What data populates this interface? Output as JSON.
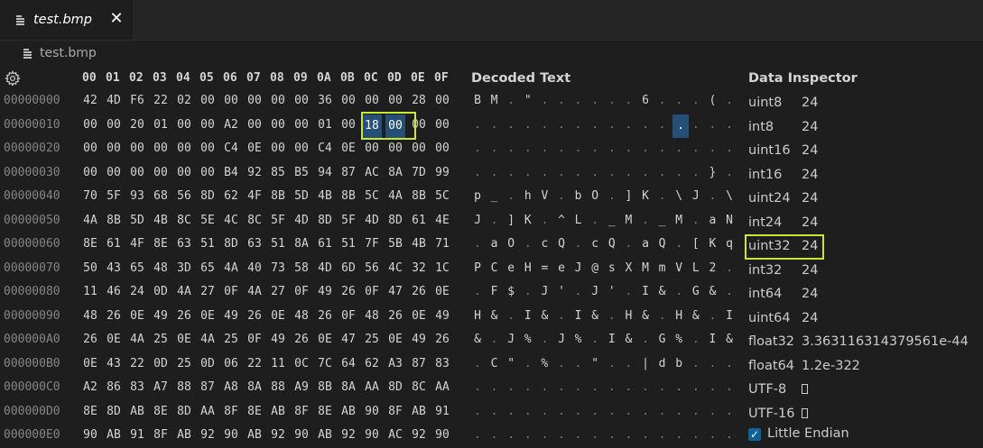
{
  "tab": {
    "title": "test.bmp",
    "close_glyph": "✕"
  },
  "breadcrumb": {
    "label": "test.bmp"
  },
  "icons": {
    "file": "file-icon",
    "settings": "gear-icon"
  },
  "hex_view": {
    "columns": [
      "00",
      "01",
      "02",
      "03",
      "04",
      "05",
      "06",
      "07",
      "08",
      "09",
      "0A",
      "0B",
      "0C",
      "0D",
      "0E",
      "0F"
    ],
    "rows": [
      {
        "addr": "00000000",
        "bytes": [
          "42",
          "4D",
          "F6",
          "22",
          "02",
          "00",
          "00",
          "00",
          "00",
          "00",
          "36",
          "00",
          "00",
          "00",
          "28",
          "00"
        ],
        "text": [
          "B",
          "M",
          ".",
          "\"",
          ".",
          ".",
          ".",
          ".",
          ".",
          ".",
          "6",
          ".",
          ".",
          ".",
          "(",
          "."
        ]
      },
      {
        "addr": "00000010",
        "bytes": [
          "00",
          "00",
          "20",
          "01",
          "00",
          "00",
          "A2",
          "00",
          "00",
          "00",
          "01",
          "00",
          "18",
          "00",
          "00",
          "00"
        ],
        "text": [
          ".",
          ".",
          ".",
          ".",
          ".",
          ".",
          ".",
          ".",
          ".",
          ".",
          ".",
          ".",
          ".",
          ".",
          ".",
          "."
        ]
      },
      {
        "addr": "00000020",
        "bytes": [
          "00",
          "00",
          "00",
          "00",
          "00",
          "00",
          "C4",
          "0E",
          "00",
          "00",
          "C4",
          "0E",
          "00",
          "00",
          "00",
          "00"
        ],
        "text": [
          ".",
          ".",
          ".",
          ".",
          ".",
          ".",
          ".",
          ".",
          ".",
          ".",
          ".",
          ".",
          ".",
          ".",
          ".",
          "."
        ]
      },
      {
        "addr": "00000030",
        "bytes": [
          "00",
          "00",
          "00",
          "00",
          "00",
          "00",
          "B4",
          "92",
          "85",
          "B5",
          "94",
          "87",
          "AC",
          "8A",
          "7D",
          "99"
        ],
        "text": [
          ".",
          ".",
          ".",
          ".",
          ".",
          ".",
          ".",
          ".",
          ".",
          ".",
          ".",
          ".",
          ".",
          ".",
          "}",
          "."
        ]
      },
      {
        "addr": "00000040",
        "bytes": [
          "70",
          "5F",
          "93",
          "68",
          "56",
          "8D",
          "62",
          "4F",
          "8B",
          "5D",
          "4B",
          "8B",
          "5C",
          "4A",
          "8B",
          "5C"
        ],
        "text": [
          "p",
          "_",
          ".",
          "h",
          "V",
          ".",
          "b",
          "O",
          ".",
          "]",
          "K",
          ".",
          "\\",
          "J",
          ".",
          "\\"
        ]
      },
      {
        "addr": "00000050",
        "bytes": [
          "4A",
          "8B",
          "5D",
          "4B",
          "8C",
          "5E",
          "4C",
          "8C",
          "5F",
          "4D",
          "8D",
          "5F",
          "4D",
          "8D",
          "61",
          "4E"
        ],
        "text": [
          "J",
          ".",
          "]",
          "K",
          ".",
          "^",
          "L",
          ".",
          "_",
          "M",
          ".",
          "_",
          "M",
          ".",
          "a",
          "N"
        ]
      },
      {
        "addr": "00000060",
        "bytes": [
          "8E",
          "61",
          "4F",
          "8E",
          "63",
          "51",
          "8D",
          "63",
          "51",
          "8A",
          "61",
          "51",
          "7F",
          "5B",
          "4B",
          "71"
        ],
        "text": [
          ".",
          "a",
          "O",
          ".",
          "c",
          "Q",
          ".",
          "c",
          "Q",
          ".",
          "a",
          "Q",
          ".",
          "[",
          "K",
          "q"
        ]
      },
      {
        "addr": "00000070",
        "bytes": [
          "50",
          "43",
          "65",
          "48",
          "3D",
          "65",
          "4A",
          "40",
          "73",
          "58",
          "4D",
          "6D",
          "56",
          "4C",
          "32",
          "1C"
        ],
        "text": [
          "P",
          "C",
          "e",
          "H",
          "=",
          "e",
          "J",
          "@",
          "s",
          "X",
          "M",
          "m",
          "V",
          "L",
          "2",
          "."
        ]
      },
      {
        "addr": "00000080",
        "bytes": [
          "11",
          "46",
          "24",
          "0D",
          "4A",
          "27",
          "0F",
          "4A",
          "27",
          "0F",
          "49",
          "26",
          "0F",
          "47",
          "26",
          "0E"
        ],
        "text": [
          ".",
          "F",
          "$",
          ".",
          "J",
          "'",
          ".",
          "J",
          "'",
          ".",
          "I",
          "&",
          ".",
          "G",
          "&",
          "."
        ]
      },
      {
        "addr": "00000090",
        "bytes": [
          "48",
          "26",
          "0E",
          "49",
          "26",
          "0E",
          "49",
          "26",
          "0E",
          "48",
          "26",
          "0F",
          "48",
          "26",
          "0E",
          "49"
        ],
        "text": [
          "H",
          "&",
          ".",
          "I",
          "&",
          ".",
          "I",
          "&",
          ".",
          "H",
          "&",
          ".",
          "H",
          "&",
          ".",
          "I"
        ]
      },
      {
        "addr": "000000A0",
        "bytes": [
          "26",
          "0E",
          "4A",
          "25",
          "0E",
          "4A",
          "25",
          "0F",
          "49",
          "26",
          "0E",
          "47",
          "25",
          "0E",
          "49",
          "26"
        ],
        "text": [
          "&",
          ".",
          "J",
          "%",
          ".",
          "J",
          "%",
          ".",
          "I",
          "&",
          ".",
          "G",
          "%",
          ".",
          "I",
          "&"
        ]
      },
      {
        "addr": "000000B0",
        "bytes": [
          "0E",
          "43",
          "22",
          "0D",
          "25",
          "0D",
          "06",
          "22",
          "11",
          "0C",
          "7C",
          "64",
          "62",
          "A3",
          "87",
          "83"
        ],
        "text": [
          ".",
          "C",
          "\"",
          ".",
          "%",
          ".",
          ".",
          "\"",
          ".",
          ".",
          "|",
          "d",
          "b",
          ".",
          ".",
          "."
        ]
      },
      {
        "addr": "000000C0",
        "bytes": [
          "A2",
          "86",
          "83",
          "A7",
          "88",
          "87",
          "A8",
          "8A",
          "88",
          "A9",
          "8B",
          "8A",
          "AA",
          "8D",
          "8C",
          "AA"
        ],
        "text": [
          ".",
          ".",
          ".",
          ".",
          ".",
          ".",
          ".",
          ".",
          ".",
          ".",
          ".",
          ".",
          ".",
          ".",
          ".",
          "."
        ]
      },
      {
        "addr": "000000D0",
        "bytes": [
          "8E",
          "8D",
          "AB",
          "8E",
          "8D",
          "AA",
          "8F",
          "8E",
          "AB",
          "8F",
          "8E",
          "AB",
          "90",
          "8F",
          "AB",
          "91"
        ],
        "text": [
          ".",
          ".",
          ".",
          ".",
          ".",
          ".",
          ".",
          ".",
          ".",
          ".",
          ".",
          ".",
          ".",
          ".",
          ".",
          "."
        ]
      },
      {
        "addr": "000000E0",
        "bytes": [
          "90",
          "AB",
          "91",
          "8F",
          "AB",
          "92",
          "90",
          "AB",
          "92",
          "90",
          "AB",
          "92",
          "90",
          "AC",
          "92",
          "90"
        ],
        "text": [
          ".",
          ".",
          ".",
          ".",
          ".",
          ".",
          ".",
          ".",
          ".",
          ".",
          ".",
          ".",
          ".",
          ".",
          ".",
          "."
        ]
      }
    ],
    "selected_bytes": [
      {
        "row": 1,
        "col": 12
      },
      {
        "row": 1,
        "col": 13
      }
    ],
    "selected_text": {
      "row": 1,
      "col": 12
    }
  },
  "decoded_text": {
    "title": "Decoded Text"
  },
  "inspector": {
    "title": "Data Inspector",
    "rows": [
      {
        "label": "uint8",
        "value": "24"
      },
      {
        "label": "int8",
        "value": "24"
      },
      {
        "label": "uint16",
        "value": "24"
      },
      {
        "label": "int16",
        "value": "24"
      },
      {
        "label": "uint24",
        "value": "24"
      },
      {
        "label": "int24",
        "value": "24"
      },
      {
        "label": "uint32",
        "value": "24"
      },
      {
        "label": "int32",
        "value": "24"
      },
      {
        "label": "int64",
        "value": "24"
      },
      {
        "label": "uint64",
        "value": "24"
      },
      {
        "label": "float32",
        "value": "3.363116314379561e-44"
      },
      {
        "label": "float64",
        "value": "1.2e-322"
      },
      {
        "label": "UTF-8",
        "value": ""
      },
      {
        "label": "UTF-16",
        "value": ""
      }
    ],
    "highlighted_row": "uint32",
    "little_endian": {
      "label": "Little Endian",
      "checked": true
    }
  },
  "colors": {
    "background": "#1e1e1e",
    "selection": "#264f78",
    "highlight_outline": "#c8e830",
    "address": "#858585"
  }
}
